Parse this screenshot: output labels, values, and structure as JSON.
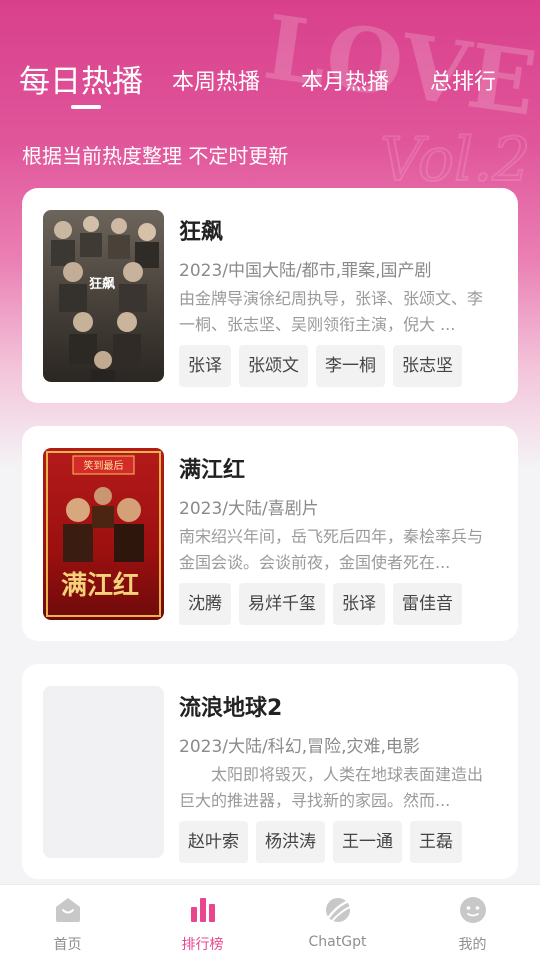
{
  "header": {
    "tabs": [
      {
        "label": "每日热播",
        "active": true
      },
      {
        "label": "本周热播",
        "active": false
      },
      {
        "label": "本月热播",
        "active": false
      },
      {
        "label": "总排行",
        "active": false
      }
    ],
    "subtitle": "根据当前热度整理 不定时更新",
    "decor_text": [
      "LOVE",
      "Vol.2"
    ]
  },
  "colors": {
    "accent": "#e9468f",
    "hero_top": "#d9408c",
    "hero_bottom": "#f4f4f6"
  },
  "list": [
    {
      "title": "狂飙",
      "meta": "2023/中国大陆/都市,罪案,国产剧",
      "description": "由金牌导演徐纪周执导，张译、张颂文、李一桐、张志坚、吴刚领衔主演，倪大 ...",
      "tags": [
        "张译",
        "张颂文",
        "李一桐",
        "张志坚"
      ],
      "poster_text": "狂飙"
    },
    {
      "title": "满江红",
      "meta": "2023/大陆/喜剧片",
      "description": "南宋绍兴年间，岳飞死后四年，秦桧率兵与金国会谈。会谈前夜，金国使者死在...",
      "tags": [
        "沈腾",
        "易烊千玺",
        "张译",
        "雷佳音"
      ],
      "poster_text": "满江红",
      "poster_caption": "笑到最后"
    },
    {
      "title": "流浪地球2",
      "meta": "2023/大陆/科幻,冒险,灾难,电影",
      "description": "　　太阳即将毁灭，人类在地球表面建造出巨大的推进器，寻找新的家园。然而...",
      "tags": [
        "赵叶索",
        "杨洪涛",
        "王一通",
        "王磊"
      ]
    }
  ],
  "bottom_nav": [
    {
      "label": "首页",
      "icon": "home-icon",
      "active": false
    },
    {
      "label": "排行榜",
      "icon": "ranking-icon",
      "active": true
    },
    {
      "label": "ChatGpt",
      "icon": "chatgpt-icon",
      "active": false
    },
    {
      "label": "我的",
      "icon": "profile-icon",
      "active": false
    }
  ]
}
